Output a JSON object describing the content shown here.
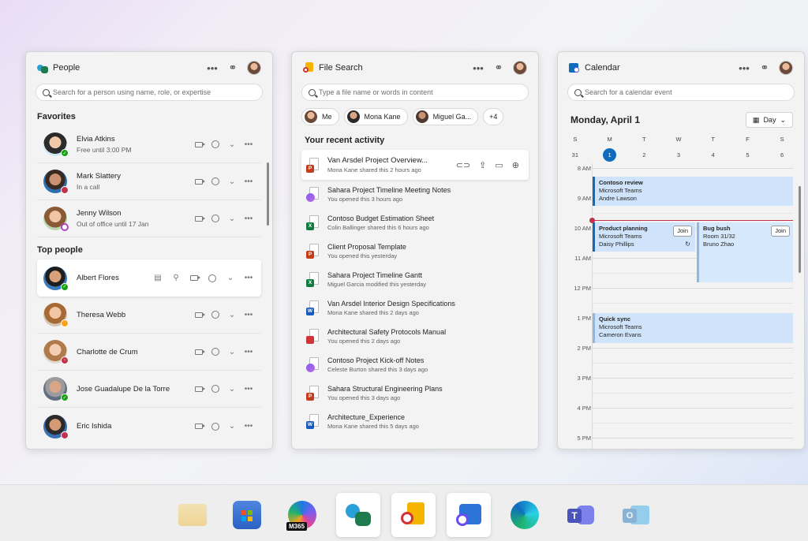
{
  "people": {
    "title": "People",
    "search_placeholder": "Search for a person using name, role, or expertise",
    "favorites_title": "Favorites",
    "top_title": "Top people",
    "favorites": [
      {
        "name": "Elvia Atkins",
        "status": "Free until 3:00 PM",
        "presence": "available"
      },
      {
        "name": "Mark Slattery",
        "status": "In a call",
        "presence": "busy"
      },
      {
        "name": "Jenny Wilson",
        "status": "Out of office until 17 Jan",
        "presence": "ooo"
      }
    ],
    "top": [
      {
        "name": "Albert Flores",
        "presence": "available"
      },
      {
        "name": "Theresa Webb",
        "presence": "away"
      },
      {
        "name": "Charlotte de Crum",
        "presence": "dnd"
      },
      {
        "name": "Jose Guadalupe De la Torre",
        "presence": "available"
      },
      {
        "name": "Eric Ishida",
        "presence": "busy"
      }
    ]
  },
  "files": {
    "title": "File Search",
    "search_placeholder": "Type a file name or words in content",
    "chips": [
      "Me",
      "Mona Kane",
      "Miguel Ga...",
      "+4"
    ],
    "recent_title": "Your recent activity",
    "items": [
      {
        "name": "Van Arsdel Project Overview...",
        "meta": "Mona Kane shared this 2 hours ago",
        "type": "ppt"
      },
      {
        "name": "Sahara Project Timeline Meeting Notes",
        "meta": "You opened this 3 hours ago",
        "type": "loop"
      },
      {
        "name": "Contoso Budget Estimation Sheet",
        "meta": "Colin Ballinger shared this 6 hours ago",
        "type": "xls"
      },
      {
        "name": "Client Proposal Template",
        "meta": "You opened this yesterday",
        "type": "ppt"
      },
      {
        "name": "Sahara Project Timeline Gantt",
        "meta": "Miguel Garcia modified this yesterday",
        "type": "xls"
      },
      {
        "name": "Van Arsdel Interior Design Specifications",
        "meta": "Mona Kane shared this 2 days ago",
        "type": "doc"
      },
      {
        "name": "Architectural Safety Protocols Manual",
        "meta": "You opened this 2 days ago",
        "type": "pdf"
      },
      {
        "name": "Contoso Project Kick-off  Notes",
        "meta": "Celeste Burton shared this 3 days ago",
        "type": "loop"
      },
      {
        "name": "Sahara Structural Engineering Plans",
        "meta": "You opened this 3 days ago",
        "type": "ppt"
      },
      {
        "name": "Architecture_Experience",
        "meta": "Mona Kane shared this 5 days ago",
        "type": "doc"
      }
    ]
  },
  "calendar": {
    "title": "Calendar",
    "search_placeholder": "Search for a calendar event",
    "date_label": "Monday, April 1",
    "view": "Day",
    "days": [
      {
        "d": "S",
        "n": "31"
      },
      {
        "d": "M",
        "n": "1"
      },
      {
        "d": "T",
        "n": "2"
      },
      {
        "d": "W",
        "n": "3"
      },
      {
        "d": "T",
        "n": "4"
      },
      {
        "d": "F",
        "n": "5"
      },
      {
        "d": "S",
        "n": "6"
      }
    ],
    "hours": [
      "8 AM",
      "9 AM",
      "10 AM",
      "11 AM",
      "12 PM",
      "1 PM",
      "2 PM",
      "3 PM",
      "4 PM",
      "5 PM"
    ],
    "events": [
      {
        "title": "Contoso review",
        "l1": "Microsoft Teams",
        "l2": "Andre Lawson"
      },
      {
        "title": "Product planning",
        "l1": "Microsoft Teams",
        "l2": "Daisy Phillips",
        "join": "Join"
      },
      {
        "title": "Bug bush",
        "l1": "Room 31/32",
        "l2": "Bruno Zhao",
        "join": "Join"
      },
      {
        "title": "Quick sync",
        "l1": "Microsoft Teams",
        "l2": "Cameron Evans"
      }
    ]
  },
  "taskbar": {
    "m365_label": "M365"
  },
  "colors": {
    "accent": "#0f6cbd",
    "available": "#13a10e",
    "busy": "#c4314b",
    "away": "#f7a21b",
    "ooo": "#b146c2",
    "ppt": "#c43e1c",
    "xls": "#107c41",
    "doc": "#185abd",
    "pdf": "#d13438"
  }
}
